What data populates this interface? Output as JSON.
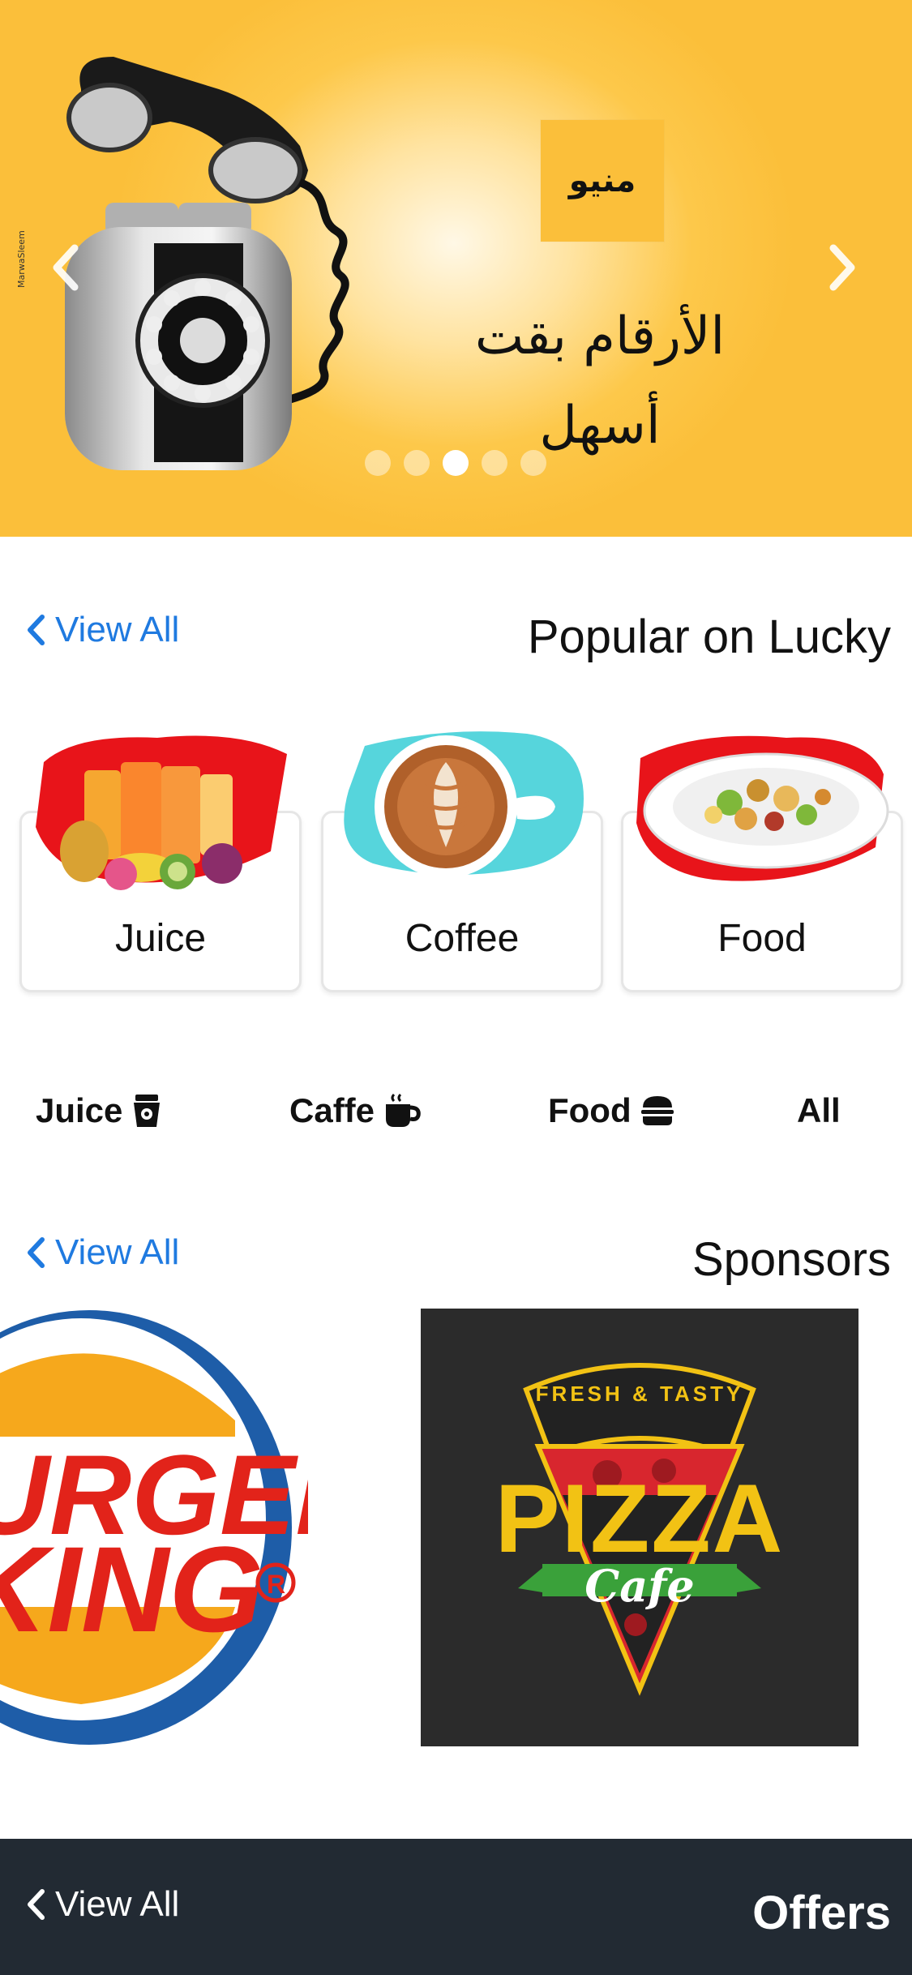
{
  "hero": {
    "badge_text": "منيو",
    "headline_line1": "الأرقام بقت",
    "headline_line2": "أسهل",
    "credit": "MarwaSleem",
    "dots": 5,
    "active_dot": 2
  },
  "popular": {
    "title": "Popular on Lucky",
    "view_all": "View All",
    "cards": [
      {
        "label": "Juice"
      },
      {
        "label": "Coffee"
      },
      {
        "label": "Food"
      }
    ]
  },
  "categories": [
    {
      "label": "Juice",
      "icon": "juice-icon"
    },
    {
      "label": "Caffe",
      "icon": "coffee-icon"
    },
    {
      "label": "Food",
      "icon": "burger-icon"
    },
    {
      "label": "All",
      "icon": ""
    }
  ],
  "sponsors": {
    "title": "Sponsors",
    "view_all": "View All",
    "burger_logo_text_line1": "URGER",
    "burger_logo_text_line2": "KING",
    "pizza_logo": {
      "top": "FRESH & TASTY",
      "main": "PIZZA",
      "sub": "Cafe"
    }
  },
  "offers": {
    "title": "Offers",
    "view_all": "View All"
  },
  "colors": {
    "accent_link": "#1f7ae0",
    "hero_yellow": "#fbbf3a",
    "bottom_bar": "#222a33"
  }
}
